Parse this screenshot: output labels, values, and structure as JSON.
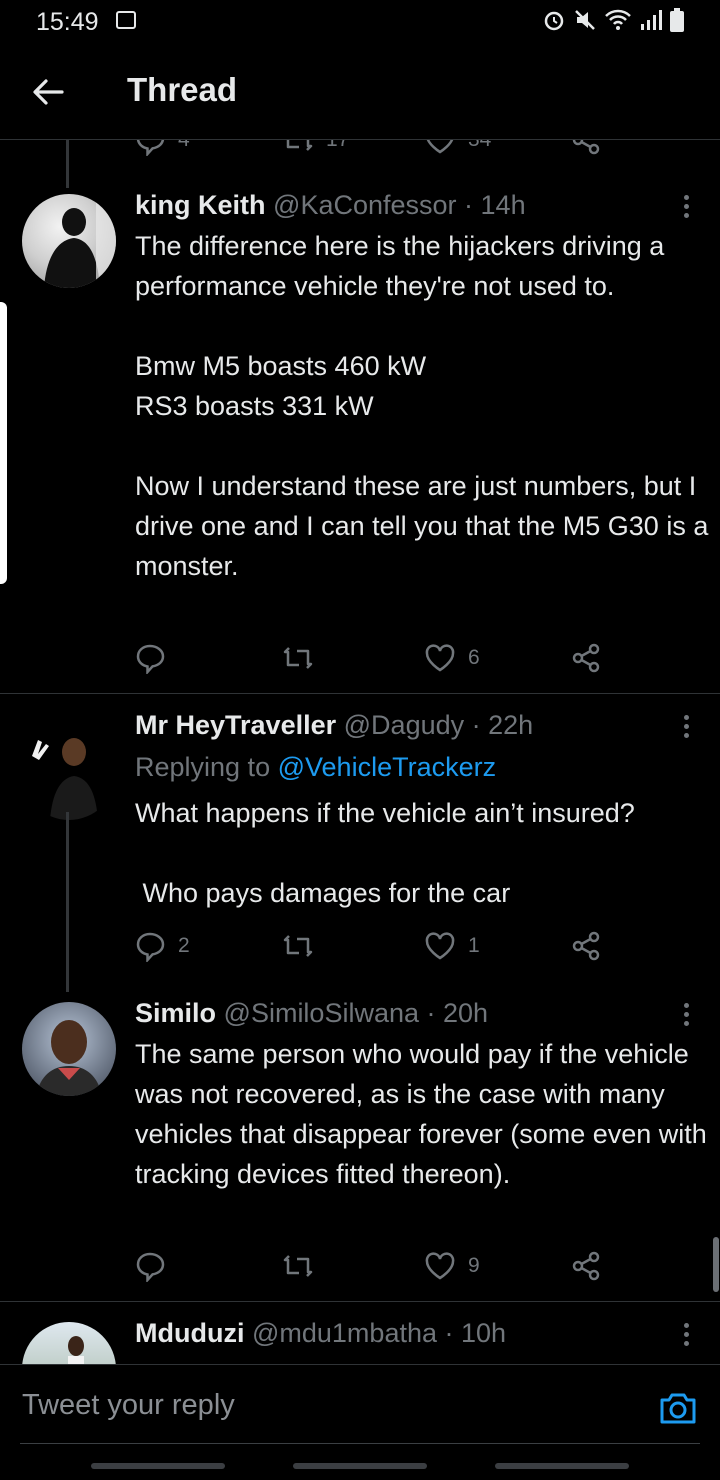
{
  "status_bar": {
    "time": "15:49"
  },
  "header": {
    "title": "Thread"
  },
  "prev_counts": {
    "replies": "4",
    "retweets": "17",
    "likes": "34"
  },
  "tweets": [
    {
      "name": "king Keith",
      "handle": "@KaConfessor",
      "time": "· 14h",
      "text": "The difference here is the hijackers driving a performance vehicle they're not used to.\n\nBmw M5 boasts 460 kW\nRS3 boasts 331 kW\n\nNow I understand these are just numbers, but I drive one and I can tell you that the M5 G30 is a monster.",
      "replies": "",
      "retweets": "",
      "likes": "6"
    },
    {
      "name": "Mr HeyTraveller",
      "handle": "@Dagudy",
      "time": "· 22h",
      "replying_label": "Replying to",
      "replying_handle": "@VehicleTrackerz",
      "text": "What happens if the vehicle ain’t insured?\n\n Who pays damages for the car",
      "replies": "2",
      "retweets": "",
      "likes": "1"
    },
    {
      "name": "Similo",
      "handle": "@SimiloSilwana",
      "time": "· 20h",
      "text": "The same person who would pay if the vehicle was not recovered, as is the case with many vehicles that disappear forever (some even with tracking devices fitted thereon).",
      "replies": "",
      "retweets": "",
      "likes": "9"
    },
    {
      "name": "Mduduzi",
      "handle": "@mdu1mbatha",
      "time": "· 10h"
    }
  ],
  "composer": {
    "placeholder": "Tweet your reply"
  }
}
